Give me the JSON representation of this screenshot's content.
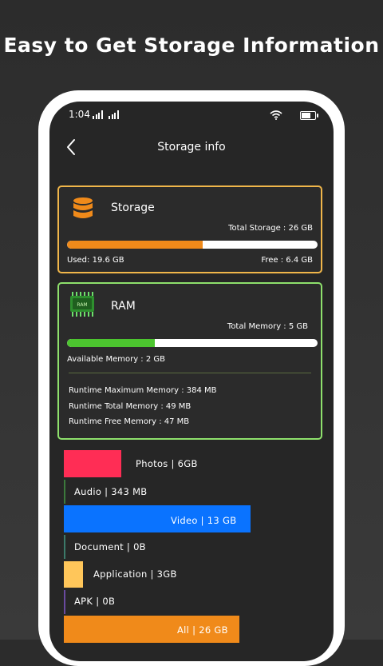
{
  "headline": "Easy to Get Storage Information",
  "status": {
    "time": "1:04"
  },
  "app_bar": {
    "title": "Storage info"
  },
  "storage": {
    "title": "Storage",
    "total_label": "Total Storage : 26 GB",
    "used_label": "Used: 19.6 GB",
    "free_label": "Free : 6.4 GB",
    "used_fraction": 0.54,
    "color": "#f08a1a"
  },
  "ram": {
    "title": "RAM",
    "icon_label": "RAM",
    "total_label": "Total Memory : 5 GB",
    "available_label": "Available Memory : 2 GB",
    "used_fraction": 0.35,
    "runtime_max": "Runtime Maximum Memory : 384 MB",
    "runtime_total": "Runtime Total Memory : 49 MB",
    "runtime_free": "Runtime Free Memory : 47 MB",
    "color": "#4cc52f"
  },
  "categories": [
    {
      "label": "Photos  |  6GB",
      "color": "#ff2d55"
    },
    {
      "label": "Audio  |  343 MB",
      "color": "#3c7a3c"
    },
    {
      "label": "Video  |  13 GB",
      "color": "#0a73ff"
    },
    {
      "label": "Document  |  0B",
      "color": "#3c7a6a"
    },
    {
      "label": "Application  |  3GB",
      "color": "#ffc65a"
    },
    {
      "label": "APK  |  0B",
      "color": "#6a4aa0"
    },
    {
      "label": "All  |  26 GB",
      "color": "#f08a1a"
    }
  ]
}
